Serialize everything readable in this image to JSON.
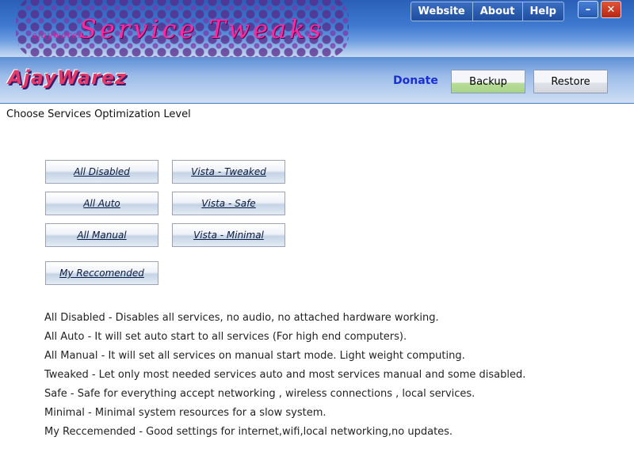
{
  "app": {
    "brand_small": "ajaywarez",
    "title": "Service Tweaks",
    "logo": "AjayWarez"
  },
  "topnav": [
    "Website",
    "About",
    "Help"
  ],
  "window_controls": {
    "minimize": "–",
    "close": "✕"
  },
  "toolbar": {
    "donate": "Donate",
    "backup": "Backup",
    "restore": "Restore"
  },
  "main": {
    "heading": "Choose Services Optimization Level",
    "options": {
      "all_disabled": "All Disabled",
      "all_auto": "All Auto",
      "all_manual": "All Manual",
      "vista_tweaked": "Vista - Tweaked",
      "vista_safe": "Vista - Safe",
      "vista_minimal": "Vista - Minimal",
      "my_recommended": "My Reccomended"
    },
    "descriptions": [
      "All Disabled - Disables all services, no audio, no attached hardware working.",
      "All Auto - It will set auto start to all services (For high end computers).",
      "All Manual - It will set all services on manual start mode. Light weight computing.",
      "Tweaked - Let only most needed services auto and most services manual and some disabled.",
      "Safe - Safe for everything accept networking , wireless connections , local services.",
      "Minimal - Minimal system resources for a slow system.",
      "My Reccemended - Good settings for internet,wifi,local networking,no updates."
    ]
  }
}
